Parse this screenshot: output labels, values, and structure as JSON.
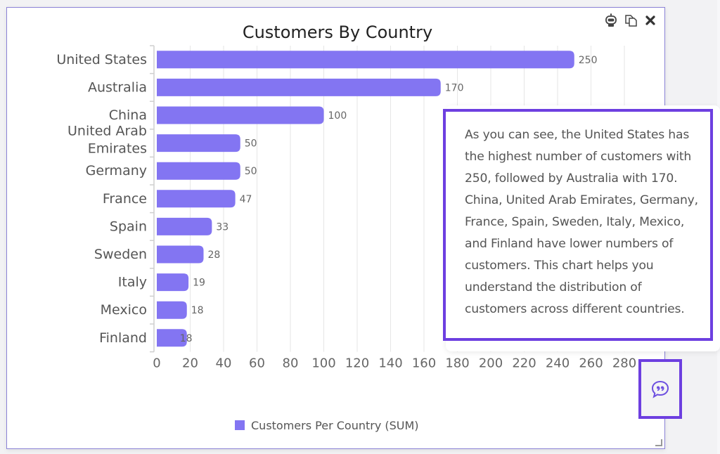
{
  "panel": {
    "tools": [
      {
        "name": "ai-assistant-icon",
        "glyph": "robot"
      },
      {
        "name": "copy-icon",
        "glyph": "copy"
      },
      {
        "name": "close-icon",
        "glyph": "✖"
      }
    ]
  },
  "chart_data": {
    "type": "bar",
    "orientation": "horizontal",
    "title": "Customers By Country",
    "categories": [
      "United States",
      "Australia",
      "China",
      "United Arab Emirates",
      "Germany",
      "France",
      "Spain",
      "Sweden",
      "Italy",
      "Mexico",
      "Finland"
    ],
    "category_lines": [
      [
        "United States"
      ],
      [
        "Australia"
      ],
      [
        "China"
      ],
      [
        "United Arab",
        "Emirates"
      ],
      [
        "Germany"
      ],
      [
        "France"
      ],
      [
        "Spain"
      ],
      [
        "Sweden"
      ],
      [
        "Italy"
      ],
      [
        "Mexico"
      ],
      [
        "Finland"
      ]
    ],
    "series": [
      {
        "name": "Customers Per Country (SUM)",
        "values": [
          250,
          170,
          100,
          50,
          50,
          47,
          33,
          28,
          19,
          18,
          18
        ],
        "color": "#8375f2"
      }
    ],
    "xlabel": "",
    "ylabel": "",
    "xlim": [
      0,
      280
    ],
    "xticks": [
      0,
      20,
      40,
      60,
      80,
      100,
      120,
      140,
      160,
      180,
      200,
      220,
      240,
      260,
      280
    ],
    "grid": true,
    "legend": "bottom-center",
    "data_labels": true
  },
  "insight": {
    "text": "As you can see, the United States has the highest number of customers with 250, followed by Australia with 170. China, United Arab Emirates, Germany, France, Spain, Sweden, Italy, Mexico, and Finland have lower numbers of customers. This chart helps you understand the distribution of customers across different countries."
  },
  "chat_button": {
    "icon": "quote-bubble-icon"
  },
  "colors": {
    "accent": "#6d3fe0",
    "bar": "#8375f2",
    "panel_border": "#8a82d6"
  }
}
